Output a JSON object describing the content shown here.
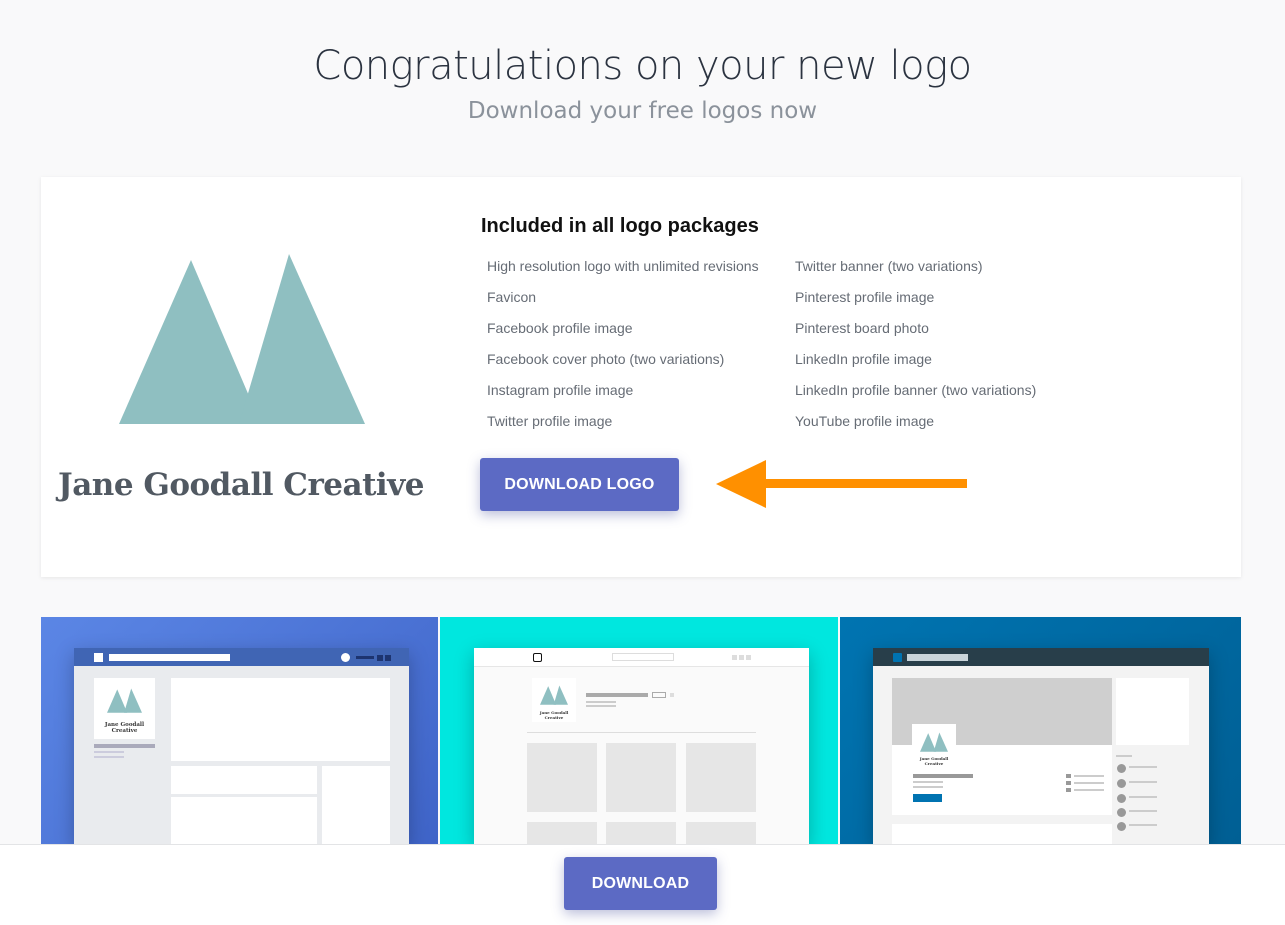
{
  "header": {
    "title": "Congratulations on your new logo",
    "subtitle": "Download your free logos now"
  },
  "logo": {
    "brand_name": "Jane Goodall Creative",
    "mark_color": "#8fbfc1"
  },
  "package": {
    "title": "Included in all logo packages",
    "features_left": [
      "High resolution logo with unlimited revisions",
      "Favicon",
      "Facebook profile image",
      "Facebook cover photo (two variations)",
      "Instagram profile image",
      "Twitter profile image"
    ],
    "features_right": [
      "Twitter banner (two variations)",
      "Pinterest profile image",
      "Pinterest board photo",
      "LinkedIn profile image",
      "LinkedIn profile banner (two variations)",
      "YouTube profile image"
    ],
    "download_logo_label": "DOWNLOAD LOGO"
  },
  "annotation": {
    "arrow_color": "#ff9000"
  },
  "mockups": {
    "facebook_bg": "#4a74d6",
    "instagram_bg": "#00e7df",
    "linkedin_bg": "#0069a3",
    "mini_brand": "Jane Goodall Creative"
  },
  "footer": {
    "download_label": "DOWNLOAD"
  },
  "colors": {
    "primary_button": "#5c6ac4"
  }
}
